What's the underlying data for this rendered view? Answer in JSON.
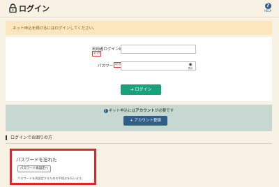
{
  "header": {
    "title": "ログイン",
    "help_symbol": "?",
    "help_label": "HELP"
  },
  "notice": "ネット申込を続けるにはログインしてください。",
  "form": {
    "user_id_label": "利用者ログインID",
    "required_badge": "必須",
    "user_id_value": "",
    "password_label": "パスワード",
    "password_value": "",
    "show_password_label": "表示",
    "login_button": "ログイン"
  },
  "registration": {
    "line_prefix": "ネット申込には",
    "line_bold": "アカウント",
    "line_suffix": "が必要です",
    "register_button": "アカウント登録"
  },
  "trouble": {
    "section_title": "ログインでお困りの方",
    "forgot_title": "パスワードを忘れた",
    "reset_button": "パスワード再設定へ",
    "description": "パスワードを再設定するための手続きを行います。"
  },
  "colors": {
    "background": "#f7f2e4",
    "notice_bg": "#fbe6bd",
    "login_green": "#17a17c",
    "register_blue": "#2f5f86",
    "highlight_red": "#e0262b"
  }
}
